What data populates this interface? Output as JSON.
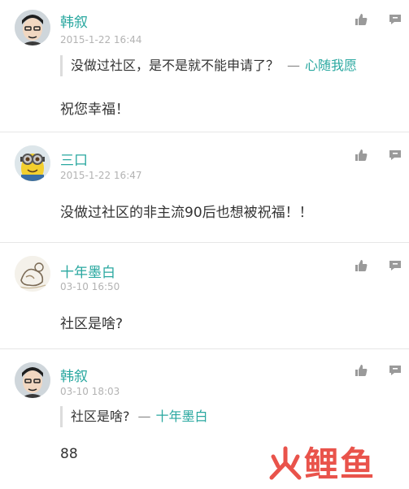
{
  "comments": [
    {
      "author": "韩叙",
      "time": "2015-1-22 16:44",
      "quote": {
        "text": "没做过社区，是不是就不能申请了？",
        "dash": "—",
        "author": "心随我愿"
      },
      "text": "祝您幸福！"
    },
    {
      "author": "三口",
      "time": "2015-1-22 16:47",
      "text": "没做过社区的非主流90后也想被祝福！！"
    },
    {
      "author": "十年墨白",
      "time": "03-10 16:50",
      "text": "社区是啥?"
    },
    {
      "author": "韩叙",
      "time": "03-10 18:03",
      "quote": {
        "text": "社区是啥?",
        "dash": "—",
        "author": "十年墨白"
      },
      "text": "88"
    }
  ],
  "watermark": "鲤鱼",
  "colors": {
    "accent": "#2aa8a0",
    "watermark": "#e8453c"
  }
}
